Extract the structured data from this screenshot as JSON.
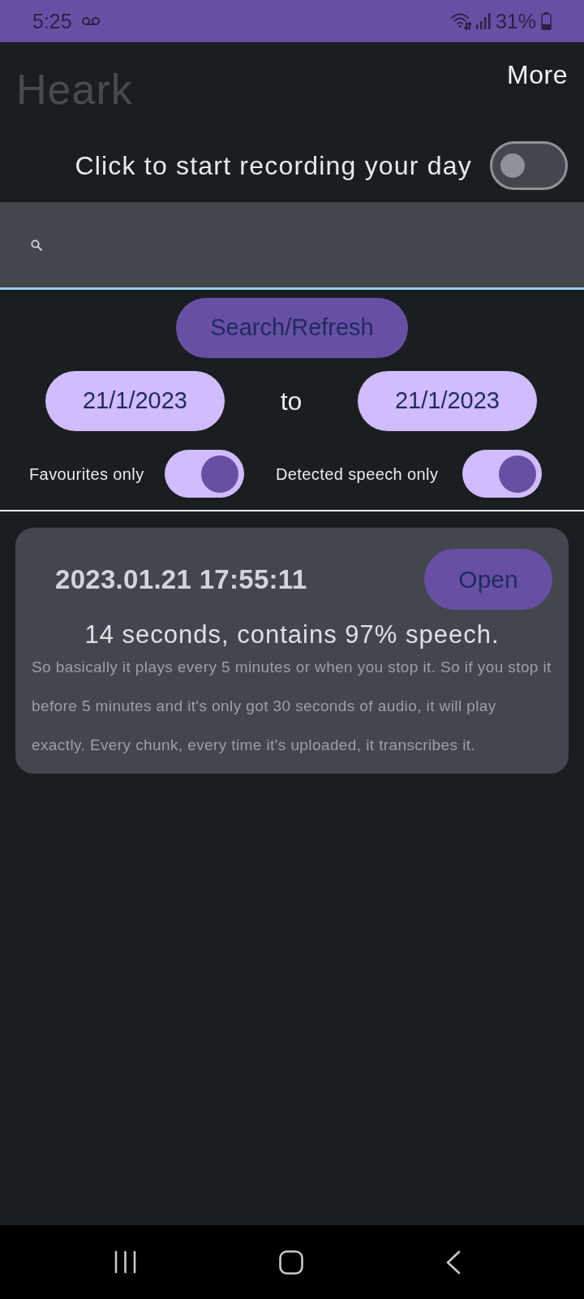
{
  "status_bar": {
    "time": "5:25",
    "battery": "31%"
  },
  "app_bar": {
    "title": "Heark",
    "menu": "More"
  },
  "recording": {
    "label": "Click to start recording your day",
    "on": false
  },
  "search_button": "Search/Refresh",
  "date_range": {
    "from": "21/1/2023",
    "separator": "to",
    "until": "21/1/2023"
  },
  "filters": [
    {
      "label": "Favourites only",
      "on": true
    },
    {
      "label": "Detected speech only",
      "on": true
    }
  ],
  "recordings": [
    {
      "timestamp": "2023.01.21 17:55:11",
      "button": "Open",
      "summary": "14 seconds, contains 97% speech.",
      "transcript": "So basically it plays every 5 minutes or when you stop it. So if you stop it before 5 minutes and it's only got 30 seconds of audio, it will play exactly. Every chunk, every time it's uploaded, it transcribes it."
    }
  ]
}
